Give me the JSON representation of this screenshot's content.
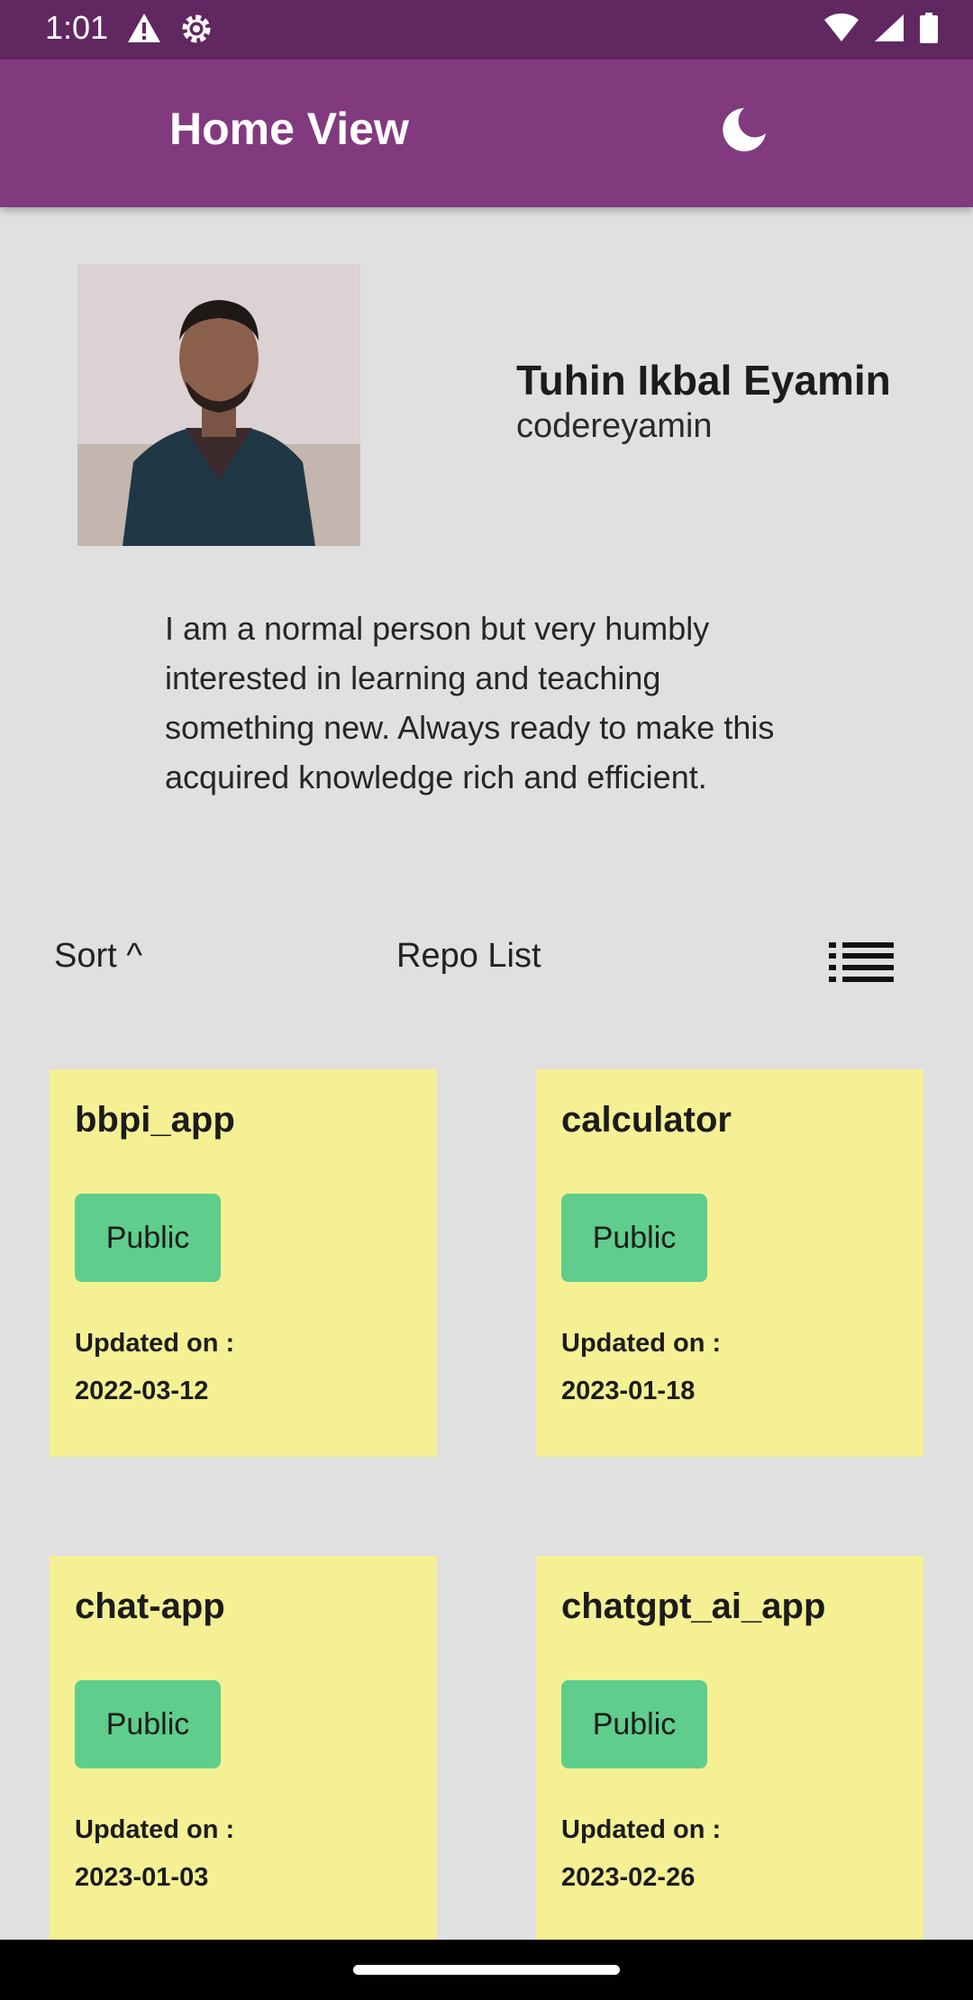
{
  "status_bar": {
    "time": "1:01",
    "left_icons": [
      "alert-icon",
      "settings-gear-icon"
    ],
    "right_icons": [
      "wifi-icon",
      "signal-icon",
      "battery-icon"
    ]
  },
  "app_bar": {
    "title": "Home View",
    "theme_icon": "moon-icon"
  },
  "profile": {
    "name": "Tuhin Ikbal Eyamin",
    "username": "codereyamin",
    "bio": "I am a normal person but very humbly interested in learning and teaching something new. Always ready to make this acquired knowledge rich and efficient."
  },
  "toolbar": {
    "sort_label": "Sort ^",
    "list_title": "Repo List",
    "view_icon": "list-view-icon"
  },
  "repos": [
    {
      "name": "bbpi_app",
      "visibility": "Public",
      "updated_label": "Updated on :",
      "updated_date": "2022-03-12"
    },
    {
      "name": "calculator",
      "visibility": "Public",
      "updated_label": "Updated on :",
      "updated_date": "2023-01-18"
    },
    {
      "name": "chat-app",
      "visibility": "Public",
      "updated_label": "Updated on :",
      "updated_date": "2023-01-03"
    },
    {
      "name": "chatgpt_ai_app",
      "visibility": "Public",
      "updated_label": "Updated on :",
      "updated_date": "2023-02-26"
    }
  ],
  "colors": {
    "status_bar": "#612760",
    "app_bar": "#823a7f",
    "background": "#e0e0e0",
    "card": "#f5f094",
    "badge": "#5fcd8c"
  }
}
